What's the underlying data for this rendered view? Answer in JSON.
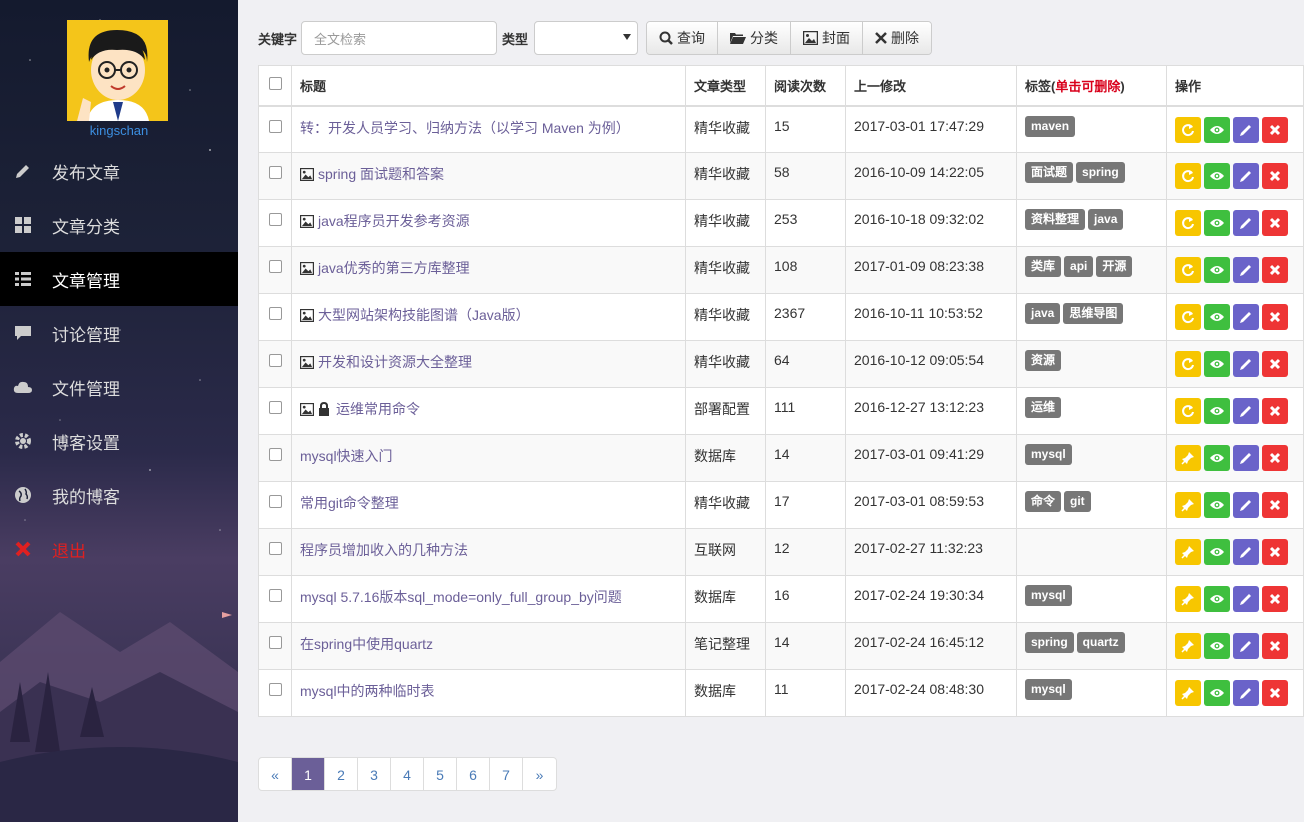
{
  "user": {
    "name": "kingschan"
  },
  "nav": [
    {
      "label": "发布文章",
      "icon": "pencil-icon"
    },
    {
      "label": "文章分类",
      "icon": "grid-icon"
    },
    {
      "label": "文章管理",
      "icon": "list-icon",
      "active": true
    },
    {
      "label": "讨论管理",
      "icon": "comment-icon"
    },
    {
      "label": "文件管理",
      "icon": "cloud-icon"
    },
    {
      "label": "博客设置",
      "icon": "gear-icon"
    },
    {
      "label": "我的博客",
      "icon": "globe-icon"
    },
    {
      "label": "退出",
      "icon": "close-icon"
    }
  ],
  "toolbar": {
    "keyword_label": "关键字",
    "search_placeholder": "全文检索",
    "type_label": "类型",
    "type_value": "",
    "query_label": "查询",
    "category_label": "分类",
    "cover_label": "封面",
    "delete_label": "删除"
  },
  "table": {
    "headers": {
      "title": "标题",
      "type": "文章类型",
      "reads": "阅读次数",
      "modified": "上一修改",
      "tags": "标签(",
      "tags_hint": "单击可删除",
      "tags_end": ")",
      "ops": "操作"
    },
    "rows": [
      {
        "title": "转：开发人员学习、归纳方法（以学习 Maven 为例）",
        "img": false,
        "lock": false,
        "type": "精华收藏",
        "reads": "15",
        "modified": "2017-03-01 17:47:29",
        "tags": [
          "maven"
        ],
        "pin": false
      },
      {
        "title": "spring 面试题和答案",
        "img": true,
        "lock": false,
        "type": "精华收藏",
        "reads": "58",
        "modified": "2016-10-09 14:22:05",
        "tags": [
          "面试题",
          "spring"
        ],
        "pin": false
      },
      {
        "title": "java程序员开发参考资源",
        "img": true,
        "lock": false,
        "type": "精华收藏",
        "reads": "253",
        "modified": "2016-10-18 09:32:02",
        "tags": [
          "资料整理",
          "java"
        ],
        "pin": false
      },
      {
        "title": "java优秀的第三方库整理",
        "img": true,
        "lock": false,
        "type": "精华收藏",
        "reads": "108",
        "modified": "2017-01-09 08:23:38",
        "tags": [
          "类库",
          "api",
          "开源"
        ],
        "pin": false
      },
      {
        "title": "大型网站架构技能图谱（Java版）",
        "img": true,
        "lock": false,
        "type": "精华收藏",
        "reads": "2367",
        "modified": "2016-10-11 10:53:52",
        "tags": [
          "java",
          "思维导图"
        ],
        "pin": false
      },
      {
        "title": "开发和设计资源大全整理",
        "img": true,
        "lock": false,
        "type": "精华收藏",
        "reads": "64",
        "modified": "2016-10-12 09:05:54",
        "tags": [
          "资源"
        ],
        "pin": false
      },
      {
        "title": "运维常用命令",
        "img": true,
        "lock": true,
        "type": "部署配置",
        "reads": "111",
        "modified": "2016-12-27 13:12:23",
        "tags": [
          "运维"
        ],
        "pin": false
      },
      {
        "title": "mysql快速入门",
        "img": false,
        "lock": false,
        "type": "数据库",
        "reads": "14",
        "modified": "2017-03-01 09:41:29",
        "tags": [
          "mysql"
        ],
        "pin": true
      },
      {
        "title": "常用git命令整理",
        "img": false,
        "lock": false,
        "type": "精华收藏",
        "reads": "17",
        "modified": "2017-03-01 08:59:53",
        "tags": [
          "命令",
          "git"
        ],
        "pin": true
      },
      {
        "title": "程序员增加收入的几种方法",
        "img": false,
        "lock": false,
        "type": "互联网",
        "reads": "12",
        "modified": "2017-02-27 11:32:23",
        "tags": [],
        "pin": true
      },
      {
        "title": "mysql 5.7.16版本sql_mode=only_full_group_by问题",
        "img": false,
        "lock": false,
        "type": "数据库",
        "reads": "16",
        "modified": "2017-02-24 19:30:34",
        "tags": [
          "mysql"
        ],
        "pin": true
      },
      {
        "title": "在spring中使用quartz",
        "img": false,
        "lock": false,
        "type": "笔记整理",
        "reads": "14",
        "modified": "2017-02-24 16:45:12",
        "tags": [
          "spring",
          "quartz"
        ],
        "pin": true
      },
      {
        "title": "mysql中的两种临时表",
        "img": false,
        "lock": false,
        "type": "数据库",
        "reads": "11",
        "modified": "2017-02-24 08:48:30",
        "tags": [
          "mysql"
        ],
        "pin": true
      }
    ]
  },
  "pagination": {
    "prev": "«",
    "pages": [
      "1",
      "2",
      "3",
      "4",
      "5",
      "6",
      "7"
    ],
    "current": "1",
    "next": "»"
  },
  "colors": {
    "accent": "#6b5f98",
    "op_yellow": "#f7c600",
    "op_green": "#3fbf3f",
    "op_blue": "#6a63c9",
    "op_red": "#ee3535",
    "tag_bg": "#777777",
    "logout_red": "#e02020"
  }
}
